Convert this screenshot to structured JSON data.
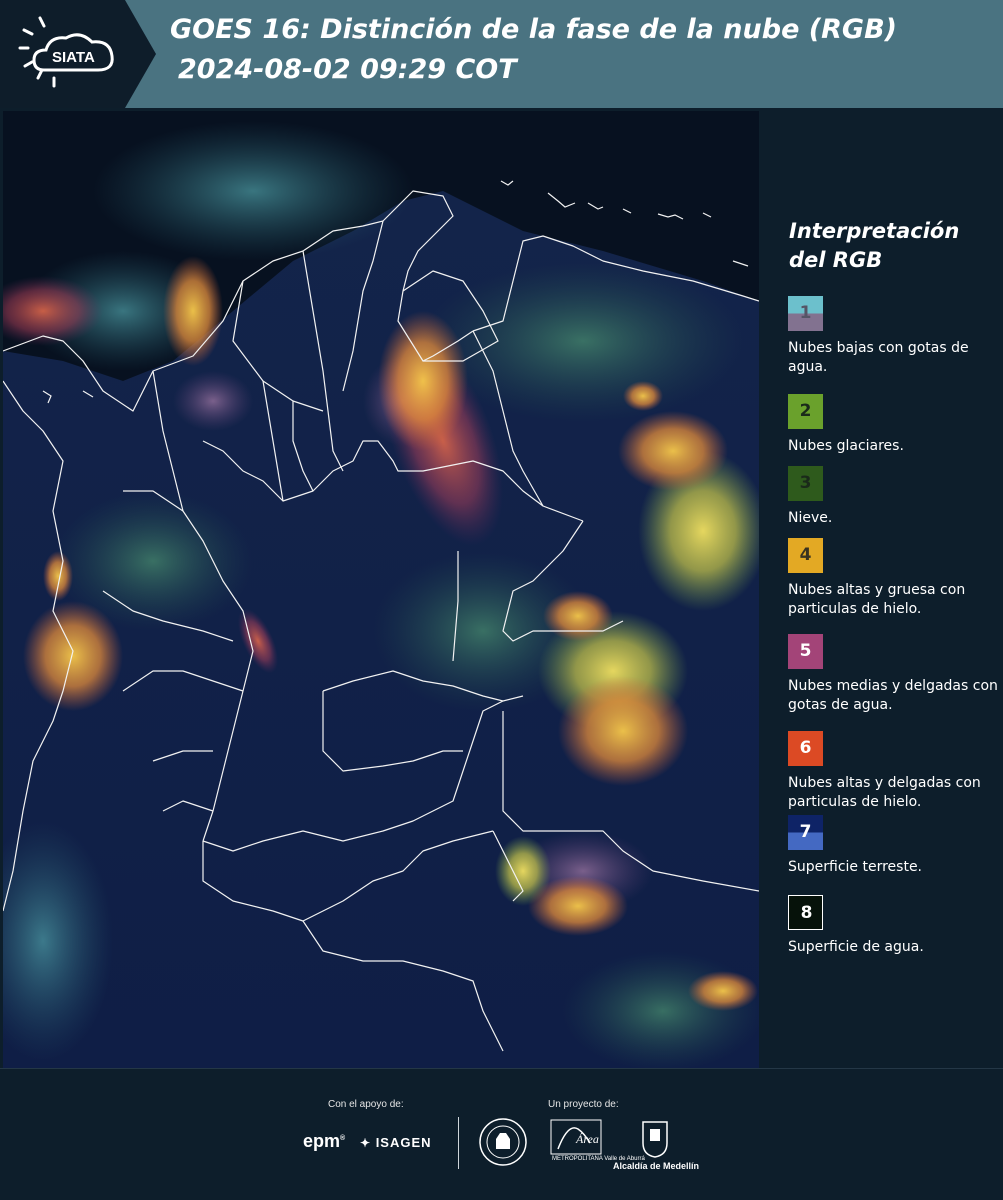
{
  "header": {
    "title": "GOES 16: Distinción de la fase de la nube (RGB)",
    "datetime": "2024-08-02 09:29 COT",
    "logo_text": "SIATA"
  },
  "legend": {
    "title": "Interpretación del RGB",
    "items": [
      {
        "num": "1",
        "label": "Nubes bajas con gotas de agua.",
        "color_top": "#6cc0cc",
        "color_bottom": "#827290"
      },
      {
        "num": "2",
        "label": "Nubes glaciares.",
        "color_top": "#6aa12c",
        "color_bottom": "#6aa12c"
      },
      {
        "num": "3",
        "label": "Nieve.",
        "color_top": "#2e5a1c",
        "color_bottom": "#2e5a1c"
      },
      {
        "num": "4",
        "label": "Nubes altas y gruesa con particulas de hielo.",
        "color_top": "#e3a924",
        "color_bottom": "#e3a924"
      },
      {
        "num": "5",
        "label": "Nubes medias y delgadas con gotas de agua.",
        "color_top": "#a34478",
        "color_bottom": "#a34478"
      },
      {
        "num": "6",
        "label": "Nubes altas y delgadas con particulas de hielo.",
        "color_top": "#dc4a24",
        "color_bottom": "#dc4a24"
      },
      {
        "num": "7",
        "label": "Superficie terreste.",
        "color_top": "#0e2366",
        "color_bottom": "#4469c2"
      },
      {
        "num": "8",
        "label": "Superficie de agua.",
        "color_top": "#06120a",
        "color_bottom": "#06120a"
      }
    ]
  },
  "footer": {
    "support_label": "Con el apoyo de:",
    "project_label": "Un proyecto de:",
    "sponsors": [
      "epm",
      "ISAGEN"
    ],
    "partners": [
      "Universidad Nacional de Colombia",
      "Área Metropolitana Valle de Aburrá",
      "Alcaldía de Medellín"
    ],
    "amva_caption": "METROPOLITANA Valle de Aburrá",
    "medellin_caption": "Alcaldía de Medellín"
  }
}
